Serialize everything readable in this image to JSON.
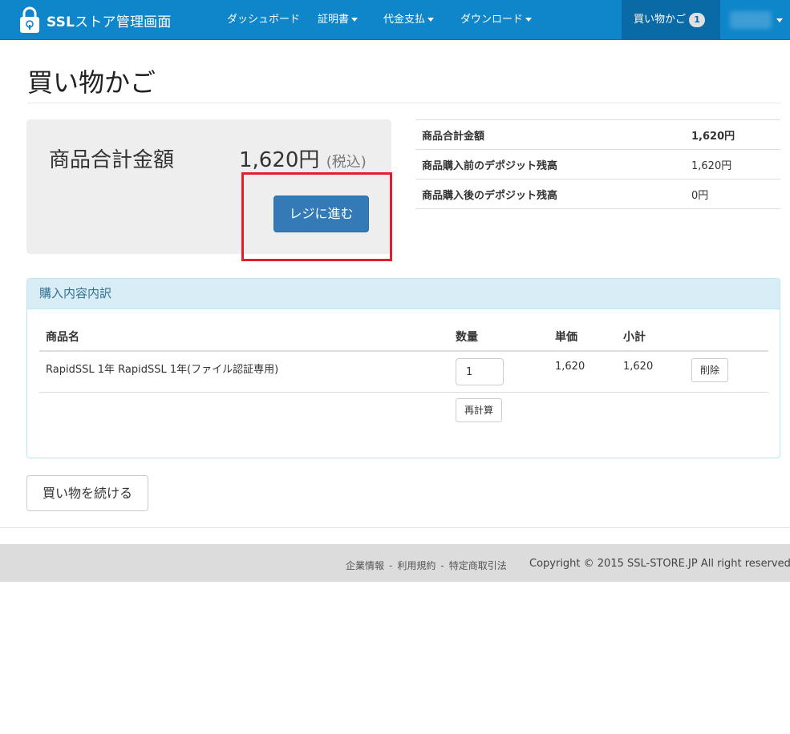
{
  "navbar": {
    "brand_bold": "SSL",
    "brand_rest": "ストア管理画面",
    "items": [
      {
        "label": "ダッシュボード",
        "has_caret": false
      },
      {
        "label": "証明書",
        "has_caret": true
      },
      {
        "label": "代金支払",
        "has_caret": true
      },
      {
        "label": "ダウンロード",
        "has_caret": true
      }
    ],
    "cart_label": "買い物かご",
    "cart_count": "1",
    "brand_color": "#0e86c9"
  },
  "page": {
    "title": "買い物かご"
  },
  "total_box": {
    "label": "商品合計金額",
    "amount": "1,620円",
    "tax_note": "(税込)",
    "checkout_button": "レジに進む",
    "highlight_color": "#e0202a"
  },
  "summary": {
    "rows": [
      {
        "label": "商品合計金額",
        "value": "1,620円",
        "bold_value": true
      },
      {
        "label": "商品購入前のデポジット残高",
        "value": "1,620円",
        "bold_value": false
      },
      {
        "label": "商品購入後のデポジット残高",
        "value": "0円",
        "bold_value": false
      }
    ]
  },
  "order_panel": {
    "heading": "購入内容内訳",
    "columns": [
      "商品名",
      "数量",
      "単価",
      "小計"
    ],
    "items": [
      {
        "name": "RapidSSL 1年 RapidSSL 1年(ファイル認証専用)",
        "quantity": "1",
        "unit_price": "1,620",
        "subtotal": "1,620",
        "delete_label": "削除"
      }
    ],
    "recalc_label": "再計算"
  },
  "continue_button": "買い物を続ける",
  "footer": {
    "links": [
      "企業情報",
      "利用規約",
      "特定商取引法"
    ],
    "separator": "-",
    "copyright": "Copyright © 2015 SSL-STORE.JP All right reserved."
  }
}
